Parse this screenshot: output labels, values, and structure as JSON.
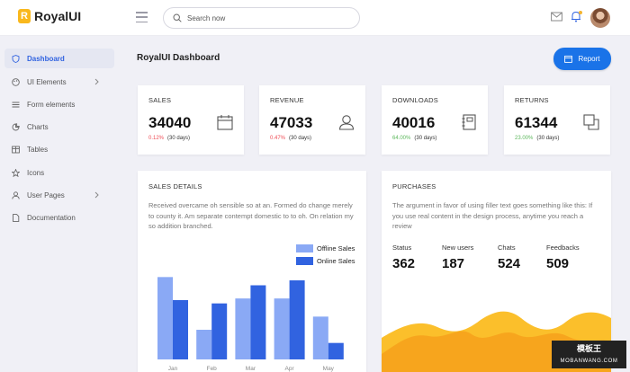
{
  "app": {
    "brand_letter": "R",
    "name": "RoyalUI"
  },
  "search": {
    "placeholder": "Search now"
  },
  "sidebar": {
    "items": [
      {
        "label": "Dashboard",
        "icon": "shield-icon"
      },
      {
        "label": "UI Elements",
        "icon": "palette-icon"
      },
      {
        "label": "Form elements",
        "icon": "form-icon"
      },
      {
        "label": "Charts",
        "icon": "chart-icon"
      },
      {
        "label": "Tables",
        "icon": "table-icon"
      },
      {
        "label": "Icons",
        "icon": "star-icon"
      },
      {
        "label": "User Pages",
        "icon": "user-icon"
      },
      {
        "label": "Documentation",
        "icon": "file-icon"
      }
    ]
  },
  "page": {
    "title": "RoyalUI Dashboard",
    "report_label": "Report"
  },
  "stats": [
    {
      "title": "SALES",
      "value": "34040",
      "pct": "0.12%",
      "period": "(30 days)",
      "icon": "calendar-icon"
    },
    {
      "title": "REVENUE",
      "value": "47033",
      "pct": "0.47%",
      "period": "(30 days)",
      "icon": "user-icon"
    },
    {
      "title": "DOWNLOADS",
      "value": "40016",
      "pct": "64.00%",
      "period": "(30 days)",
      "icon": "notebook-icon"
    },
    {
      "title": "RETURNS",
      "value": "61344",
      "pct": "23.00%",
      "period": "(30 days)",
      "icon": "copy-icon"
    }
  ],
  "sales_details": {
    "title": "SALES DETAILS",
    "text": "Received overcame oh sensible so at an. Formed do change merely to county it. Am separate contempt domestic to to oh. On relation my so addition branched."
  },
  "purchases": {
    "title": "PURCHASES",
    "text": "The argument in favor of using filler text goes something like this: If you use real content in the design process, anytime you reach a review",
    "stats": [
      {
        "label": "Status",
        "value": "362"
      },
      {
        "label": "New users",
        "value": "187"
      },
      {
        "label": "Chats",
        "value": "524"
      },
      {
        "label": "Feedbacks",
        "value": "509"
      }
    ]
  },
  "colors": {
    "accent": "#1a73e8",
    "offline": "#8aa9f5",
    "online": "#3163e0",
    "wave_dark": "#f7a51d",
    "wave_light": "#fbbf2b"
  },
  "watermark": {
    "text": "模板王",
    "sub": "MOBANWANG.COM"
  },
  "chart_data": {
    "type": "bar",
    "categories": [
      "Jan",
      "Feb",
      "Mar",
      "Apr",
      "May"
    ],
    "series": [
      {
        "name": "Offline Sales",
        "values": [
          50,
          18,
          37,
          37,
          26
        ]
      },
      {
        "name": "Online Sales",
        "values": [
          36,
          34,
          45,
          48,
          10
        ]
      }
    ],
    "ylim": [
      0,
      60
    ],
    "legend": "top-right",
    "grid": false
  }
}
